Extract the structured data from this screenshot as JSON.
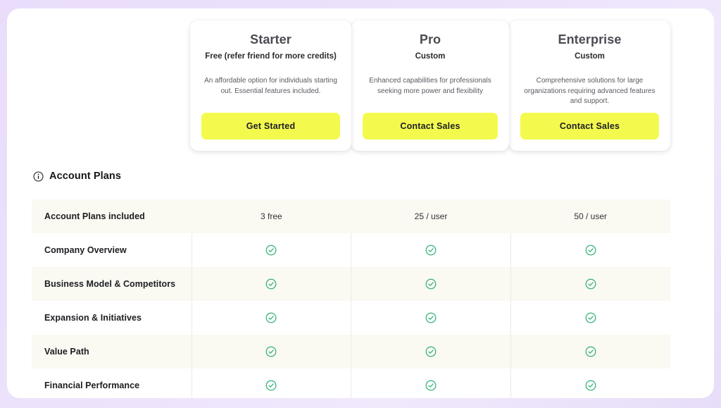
{
  "theme": {
    "page_background": "#ece2fb",
    "card_background": "#ffffff",
    "cta_yellow": "#f4fa4d",
    "check_green": "#34b07a",
    "row_tint": "#faf9f2"
  },
  "plans": [
    {
      "name": "Starter",
      "price": "Free (refer friend for more credits)",
      "description": "An affordable option for individuals starting out. Essential features included.",
      "cta_label": "Get Started"
    },
    {
      "name": "Pro",
      "price": "Custom",
      "description": "Enhanced capabilities for professionals seeking more power and flexibility",
      "cta_label": "Contact Sales"
    },
    {
      "name": "Enterprise",
      "price": "Custom",
      "description": "Comprehensive solutions for large organizations requiring advanced features and support.",
      "cta_label": "Contact Sales"
    }
  ],
  "section": {
    "title": "Account Plans",
    "info_icon": "info-circle-icon"
  },
  "comparison_table": {
    "header": {
      "feature_label": "Account Plans included",
      "values": [
        "3 free",
        "25 / user",
        "50 / user"
      ]
    },
    "rows": [
      {
        "feature": "Company Overview",
        "values": [
          "check-circle-icon",
          "check-circle-icon",
          "check-circle-icon"
        ]
      },
      {
        "feature": "Business Model & Competitors",
        "values": [
          "check-circle-icon",
          "check-circle-icon",
          "check-circle-icon"
        ]
      },
      {
        "feature": "Expansion & Initiatives",
        "values": [
          "check-circle-icon",
          "check-circle-icon",
          "check-circle-icon"
        ]
      },
      {
        "feature": "Value Path",
        "values": [
          "check-circle-icon",
          "check-circle-icon",
          "check-circle-icon"
        ]
      },
      {
        "feature": "Financial Performance",
        "values": [
          "check-circle-icon",
          "check-circle-icon",
          "check-circle-icon"
        ]
      }
    ]
  }
}
